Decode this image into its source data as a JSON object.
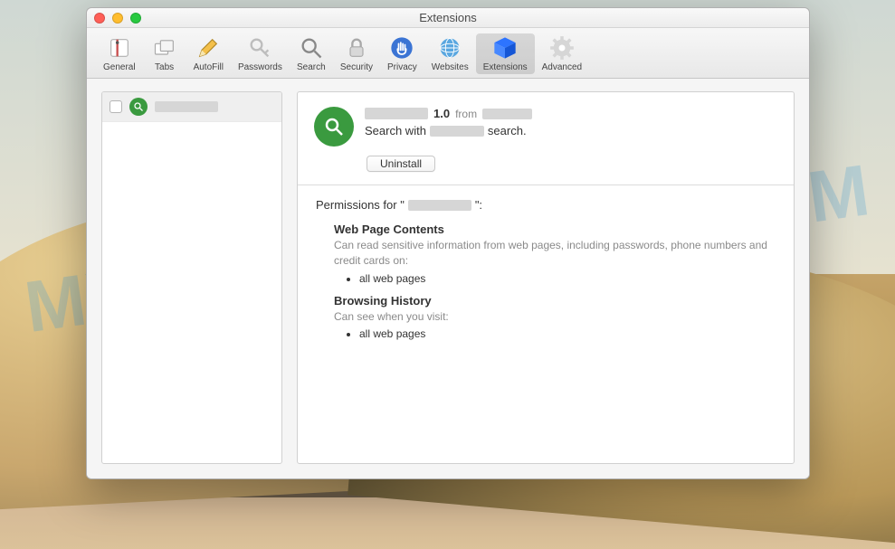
{
  "watermark": "MYANTISPYWARE.COM",
  "window": {
    "title": "Extensions"
  },
  "toolbar": {
    "items": [
      {
        "id": "general",
        "label": "General"
      },
      {
        "id": "tabs",
        "label": "Tabs"
      },
      {
        "id": "autofill",
        "label": "AutoFill"
      },
      {
        "id": "passwords",
        "label": "Passwords"
      },
      {
        "id": "search",
        "label": "Search"
      },
      {
        "id": "security",
        "label": "Security"
      },
      {
        "id": "privacy",
        "label": "Privacy"
      },
      {
        "id": "websites",
        "label": "Websites"
      },
      {
        "id": "extensions",
        "label": "Extensions",
        "active": true
      },
      {
        "id": "advanced",
        "label": "Advanced"
      }
    ]
  },
  "sidebar": {
    "items": [
      {
        "name_redacted": true
      }
    ]
  },
  "detail": {
    "name_redacted": true,
    "version": "1.0",
    "from_label": "from",
    "publisher_redacted": true,
    "desc_prefix": "Search with",
    "desc_mid_redacted": true,
    "desc_suffix": "search.",
    "uninstall_label": "Uninstall"
  },
  "permissions": {
    "title_prefix": "Permissions for \"",
    "title_name_redacted": true,
    "title_suffix": "\":",
    "sections": [
      {
        "heading": "Web Page Contents",
        "desc": "Can read sensitive information from web pages, including passwords, phone numbers and credit cards on:",
        "bullets": [
          "all web pages"
        ]
      },
      {
        "heading": "Browsing History",
        "desc": "Can see when you visit:",
        "bullets": [
          "all web pages"
        ]
      }
    ]
  }
}
